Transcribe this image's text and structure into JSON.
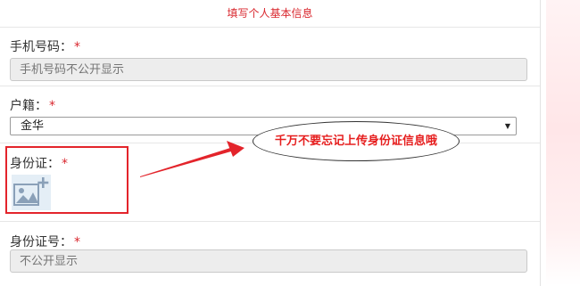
{
  "form": {
    "title": "填写个人基本信息"
  },
  "phone": {
    "label": "手机号码：",
    "required_mark": "*",
    "placeholder": "手机号码不公开显示"
  },
  "hukou": {
    "label": "户籍：",
    "required_mark": "*",
    "selected_value": "金华",
    "arrow": "▼"
  },
  "id_card": {
    "label": "身份证：",
    "required_mark": "*",
    "upload_icon": "add-image-icon"
  },
  "id_number": {
    "label": "身份证号：",
    "required_mark": "*",
    "placeholder": "不公开显示"
  },
  "annotation": {
    "text": "千万不要忘记上传身份证信息哦"
  },
  "colors": {
    "accent": "#d9272e",
    "input_bg": "#ededed",
    "callout_red": "#e61e1e"
  }
}
